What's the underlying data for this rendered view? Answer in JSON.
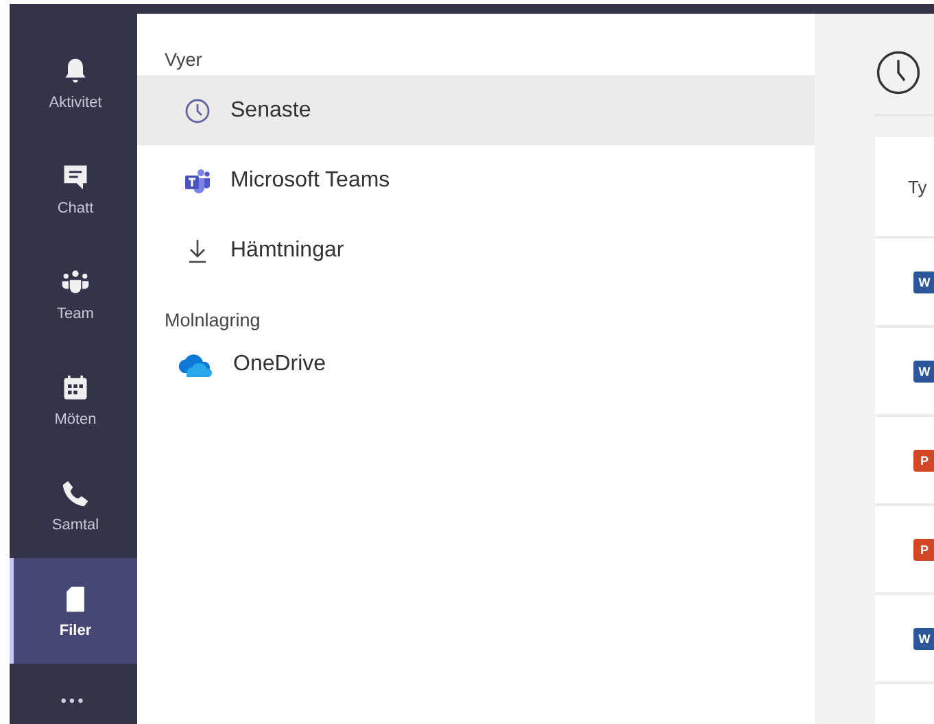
{
  "rail": [
    {
      "kind": "bell",
      "label": "Aktivitet",
      "selected": false
    },
    {
      "kind": "chat",
      "label": "Chatt",
      "selected": false
    },
    {
      "kind": "team",
      "label": "Team",
      "selected": false
    },
    {
      "kind": "calendar",
      "label": "Möten",
      "selected": false
    },
    {
      "kind": "phone",
      "label": "Samtal",
      "selected": false
    },
    {
      "kind": "file",
      "label": "Filer",
      "selected": true
    }
  ],
  "more": "•••",
  "sections": [
    {
      "heading": "Vyer",
      "items": [
        {
          "kind": "clock",
          "label": "Senaste",
          "selected": true
        },
        {
          "kind": "teams",
          "label": "Microsoft Teams",
          "selected": false
        },
        {
          "kind": "download",
          "label": "Hämtningar",
          "selected": false
        }
      ]
    },
    {
      "heading": "Molnlagring",
      "items": [
        {
          "kind": "cloud",
          "label": "OneDrive",
          "selected": false
        }
      ]
    }
  ],
  "content": {
    "column_1": "Ty",
    "rows": [
      {
        "kind": "word",
        "letter": "W"
      },
      {
        "kind": "word",
        "letter": "W"
      },
      {
        "kind": "powerpoint",
        "letter": "P"
      },
      {
        "kind": "powerpoint",
        "letter": "P"
      },
      {
        "kind": "word",
        "letter": "W"
      }
    ]
  }
}
